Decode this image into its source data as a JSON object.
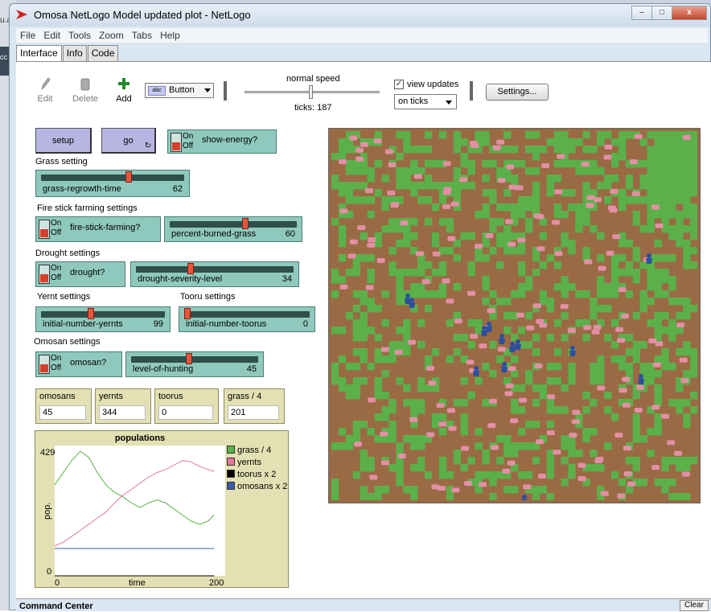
{
  "desktop": {
    "left_fragment_1": "u.a",
    "left_fragment_2": "cc"
  },
  "window": {
    "title": "Omosa NetLogo Model updated plot - NetLogo",
    "minimize": "–",
    "maximize": "□",
    "close": "x"
  },
  "menu": [
    "File",
    "Edit",
    "Tools",
    "Zoom",
    "Tabs",
    "Help"
  ],
  "tabs": [
    "Interface",
    "Info",
    "Code"
  ],
  "toolbar": {
    "edit": "Edit",
    "delete": "Delete",
    "add": "Add",
    "widget_type": "Button",
    "widget_badge": "abc",
    "speed_label": "normal speed",
    "speed_fraction": 0.5,
    "ticks_label": "ticks: 187",
    "view_updates_label": "view updates",
    "view_updates_checked": true,
    "update_mode": "on ticks",
    "settings": "Settings..."
  },
  "buttons": {
    "setup": "setup",
    "go": "go"
  },
  "switches": {
    "show_energy": {
      "name": "show-energy?",
      "on": "On",
      "off": "Off"
    },
    "fire_stick": {
      "name": "fire-stick-farming?",
      "on": "On",
      "off": "Off"
    },
    "drought": {
      "name": "drought?",
      "on": "On",
      "off": "Off"
    },
    "omosan": {
      "name": "omosan?",
      "on": "On",
      "off": "Off"
    }
  },
  "sections": {
    "grass": "Grass setting",
    "fire": "Fire stick farming settings",
    "drought": "Drought settings",
    "yernt": "Yernt settings",
    "tooru": "Tooru settings",
    "omosan": "Omosan settings"
  },
  "sliders": {
    "grass_regrowth": {
      "name": "grass-regrowth-time",
      "value": "62",
      "fraction": 0.62
    },
    "percent_burned": {
      "name": "percent-burned-grass",
      "value": "60",
      "fraction": 0.6
    },
    "drought_severity": {
      "name": "drought-severity-level",
      "value": "34",
      "fraction": 0.34
    },
    "initial_yernts": {
      "name": "initial-number-yernts",
      "value": "99",
      "fraction": 0.4
    },
    "initial_toorus": {
      "name": "initial-number-toorus",
      "value": "0",
      "fraction": 0.0
    },
    "level_hunting": {
      "name": "level-of-hunting",
      "value": "45",
      "fraction": 0.45
    }
  },
  "monitors": [
    {
      "name": "omosans",
      "value": "45"
    },
    {
      "name": "yernts",
      "value": "344"
    },
    {
      "name": "toorus",
      "value": "0"
    },
    {
      "name": "grass / 4",
      "value": "201"
    }
  ],
  "chart_data": {
    "type": "line",
    "title": "populations",
    "xlabel": "time",
    "ylabel": "pop.",
    "xlim": [
      0,
      200
    ],
    "ylim": [
      0,
      429
    ],
    "x_ticks": [
      "0",
      "200"
    ],
    "y_ticks": [
      "0",
      "429"
    ],
    "legend": "right",
    "series": [
      {
        "name": "grass / 4",
        "color": "#5bb04a",
        "x": [
          0,
          10,
          20,
          30,
          40,
          50,
          60,
          70,
          80,
          90,
          100,
          110,
          120,
          130,
          140,
          150,
          160,
          170,
          180,
          187
        ],
        "values": [
          300,
          340,
          380,
          410,
          390,
          340,
          300,
          275,
          260,
          240,
          225,
          240,
          250,
          240,
          220,
          200,
          180,
          170,
          180,
          201
        ]
      },
      {
        "name": "yernts",
        "color": "#e07a96",
        "x": [
          0,
          10,
          20,
          30,
          40,
          50,
          60,
          70,
          80,
          90,
          100,
          110,
          120,
          130,
          140,
          150,
          160,
          170,
          180,
          187
        ],
        "values": [
          99,
          110,
          130,
          150,
          170,
          190,
          210,
          240,
          265,
          285,
          305,
          325,
          340,
          350,
          365,
          380,
          375,
          360,
          350,
          344
        ]
      },
      {
        "name": "toorus x 2",
        "color": "#000000",
        "x": [
          0,
          187
        ],
        "values": [
          0,
          0
        ]
      },
      {
        "name": "omosans x 2",
        "color": "#3a5ca8",
        "x": [
          0,
          187
        ],
        "values": [
          90,
          90
        ]
      }
    ]
  },
  "view": {
    "background": "#9a6a44",
    "grass_color": "#5bb04a",
    "yernt_color": "#e38fa6",
    "omosan_color": "#2b4fa0",
    "patches_x": 51,
    "patches_y": 51
  },
  "statusbar": {
    "command_center": "Command Center",
    "clear": "Clear"
  }
}
